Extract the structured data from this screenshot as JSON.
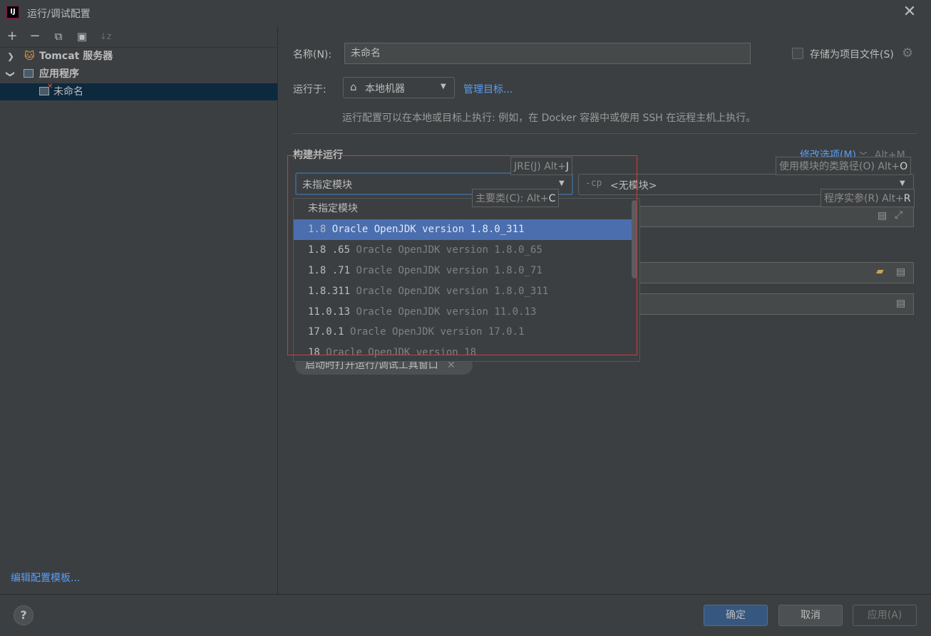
{
  "window": {
    "title": "运行/调试配置",
    "icon_text": "IJ"
  },
  "toolbar": {
    "add": "+",
    "remove": "−",
    "copy": "⧉",
    "folder": "▣",
    "sort": "↓z"
  },
  "tree": [
    {
      "label": "Tomcat 服务器",
      "expanded": false
    },
    {
      "label": "应用程序",
      "expanded": true
    },
    {
      "label": "未命名",
      "selected": true
    }
  ],
  "edit_templates_link": "编辑配置模板...",
  "form": {
    "name_label": "名称(N):",
    "name_value": "未命名",
    "store_as_project_file": "存储为项目文件(S)",
    "run_on_label": "运行于:",
    "run_on_value": "本地机器",
    "manage_targets": "管理目标...",
    "run_on_hint": "运行配置可以在本地或目标上执行: 例如，在 Docker 容器中或使用 SSH 在远程主机上执行。",
    "section_title": "构建并运行",
    "modify_options": "修改选项(M)",
    "modify_shortcut": "Alt+M",
    "module_combo_value": "未指定模块",
    "cp_prefix": "-cp",
    "cp_value": "<无模块>",
    "chip_text": "启动时打开运行/调试工具窗口"
  },
  "tooltips": {
    "jre": {
      "text": "JRE(J) Alt+",
      "key": "J"
    },
    "main_class": {
      "text": "主要类(C): Alt+",
      "key": "C"
    },
    "module_classpath": {
      "text": "使用模块的类路径(O) Alt+",
      "key": "O"
    },
    "program_args": {
      "text": "程序实参(R) Alt+",
      "key": "R"
    }
  },
  "dropdown": {
    "items": [
      {
        "version": "未指定模块",
        "desc": ""
      },
      {
        "version": "1.8",
        "desc": "Oracle OpenJDK version 1.8.0_311",
        "selected": true
      },
      {
        "version": "1.8 .65",
        "desc": "Oracle OpenJDK version 1.8.0_65"
      },
      {
        "version": "1.8 .71",
        "desc": "Oracle OpenJDK version 1.8.0_71"
      },
      {
        "version": "1.8.311",
        "desc": "Oracle OpenJDK version 1.8.0_311"
      },
      {
        "version": "11.0.13",
        "desc": "Oracle OpenJDK version 11.0.13"
      },
      {
        "version": "17.0.1",
        "desc": "Oracle OpenJDK version 17.0.1"
      },
      {
        "version": "18",
        "desc": "Oracle OpenJDK version 18"
      }
    ]
  },
  "buttons": {
    "ok": "确定",
    "cancel": "取消",
    "apply": "应用(A)",
    "help": "?"
  },
  "colors": {
    "background": "#3c3f41",
    "accent": "#4b6eaf",
    "link": "#589df6",
    "highlight_box": "#d03a3a"
  }
}
